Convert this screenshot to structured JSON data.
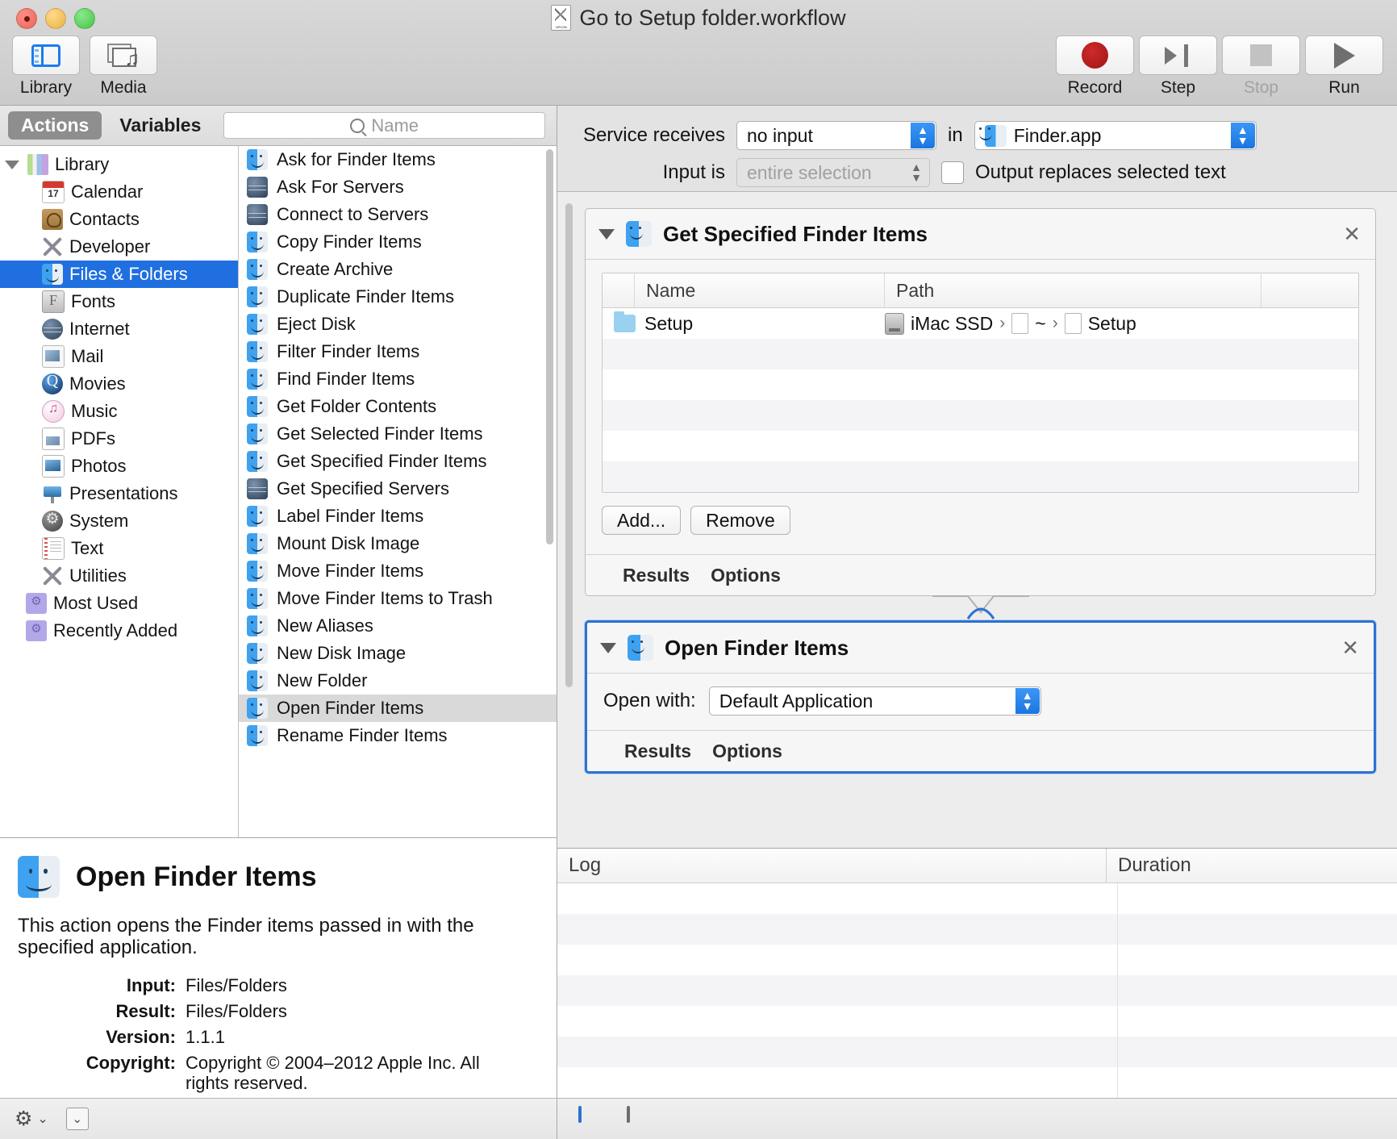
{
  "window": {
    "title": "Go to Setup folder.workflow",
    "title_icon": "workflow-document-icon"
  },
  "toolbar": {
    "left": [
      {
        "label": "Library",
        "icon": "library-panel-icon"
      },
      {
        "label": "Media",
        "icon": "media-browser-icon"
      }
    ],
    "right": [
      {
        "label": "Record",
        "icon": "record-icon",
        "enabled": true
      },
      {
        "label": "Step",
        "icon": "step-icon",
        "enabled": true
      },
      {
        "label": "Stop",
        "icon": "stop-icon",
        "enabled": false
      },
      {
        "label": "Run",
        "icon": "run-icon",
        "enabled": true
      }
    ]
  },
  "library": {
    "tabs": [
      {
        "label": "Actions",
        "selected": true
      },
      {
        "label": "Variables",
        "selected": false
      }
    ],
    "search": {
      "placeholder": "Name",
      "value": "",
      "icon": "search-icon"
    },
    "categories": [
      {
        "label": "Library",
        "icon": "library-books-icon",
        "level": "root",
        "expanded": true,
        "selected": false
      },
      {
        "label": "Calendar",
        "icon": "calendar-icon",
        "level": "child",
        "selected": false
      },
      {
        "label": "Contacts",
        "icon": "contacts-icon",
        "level": "child",
        "selected": false
      },
      {
        "label": "Developer",
        "icon": "developer-tools-icon",
        "level": "child",
        "selected": false
      },
      {
        "label": "Files & Folders",
        "icon": "finder-icon",
        "level": "child",
        "selected": true
      },
      {
        "label": "Fonts",
        "icon": "fonts-icon",
        "level": "child",
        "selected": false
      },
      {
        "label": "Internet",
        "icon": "globe-icon",
        "level": "child",
        "selected": false
      },
      {
        "label": "Mail",
        "icon": "mail-icon",
        "level": "child",
        "selected": false
      },
      {
        "label": "Movies",
        "icon": "quicktime-icon",
        "level": "child",
        "selected": false
      },
      {
        "label": "Music",
        "icon": "itunes-icon",
        "level": "child",
        "selected": false
      },
      {
        "label": "PDFs",
        "icon": "pdf-icon",
        "level": "child",
        "selected": false
      },
      {
        "label": "Photos",
        "icon": "photos-icon",
        "level": "child",
        "selected": false
      },
      {
        "label": "Presentations",
        "icon": "keynote-icon",
        "level": "child",
        "selected": false
      },
      {
        "label": "System",
        "icon": "system-prefs-icon",
        "level": "child",
        "selected": false
      },
      {
        "label": "Text",
        "icon": "textedit-icon",
        "level": "child",
        "selected": false
      },
      {
        "label": "Utilities",
        "icon": "utilities-icon",
        "level": "child",
        "selected": false
      },
      {
        "label": "Most Used",
        "icon": "smart-folder-icon",
        "level": "root2",
        "selected": false
      },
      {
        "label": "Recently Added",
        "icon": "smart-folder-icon",
        "level": "root2",
        "selected": false
      }
    ],
    "actions": [
      {
        "label": "Ask for Finder Items",
        "icon": "finder-icon",
        "selected": false
      },
      {
        "label": "Ask For Servers",
        "icon": "globe-icon",
        "selected": false
      },
      {
        "label": "Connect to Servers",
        "icon": "globe-icon",
        "selected": false
      },
      {
        "label": "Copy Finder Items",
        "icon": "finder-icon",
        "selected": false
      },
      {
        "label": "Create Archive",
        "icon": "finder-icon",
        "selected": false
      },
      {
        "label": "Duplicate Finder Items",
        "icon": "finder-icon",
        "selected": false
      },
      {
        "label": "Eject Disk",
        "icon": "finder-icon",
        "selected": false
      },
      {
        "label": "Filter Finder Items",
        "icon": "finder-icon",
        "selected": false
      },
      {
        "label": "Find Finder Items",
        "icon": "finder-icon",
        "selected": false
      },
      {
        "label": "Get Folder Contents",
        "icon": "finder-icon",
        "selected": false
      },
      {
        "label": "Get Selected Finder Items",
        "icon": "finder-icon",
        "selected": false
      },
      {
        "label": "Get Specified Finder Items",
        "icon": "finder-icon",
        "selected": false
      },
      {
        "label": "Get Specified Servers",
        "icon": "globe-icon",
        "selected": false
      },
      {
        "label": "Label Finder Items",
        "icon": "finder-icon",
        "selected": false
      },
      {
        "label": "Mount Disk Image",
        "icon": "finder-icon",
        "selected": false
      },
      {
        "label": "Move Finder Items",
        "icon": "finder-icon",
        "selected": false
      },
      {
        "label": "Move Finder Items to Trash",
        "icon": "finder-icon",
        "selected": false
      },
      {
        "label": "New Aliases",
        "icon": "finder-icon",
        "selected": false
      },
      {
        "label": "New Disk Image",
        "icon": "finder-icon",
        "selected": false
      },
      {
        "label": "New Folder",
        "icon": "finder-icon",
        "selected": false
      },
      {
        "label": "Open Finder Items",
        "icon": "finder-icon",
        "selected": true
      },
      {
        "label": "Rename Finder Items",
        "icon": "finder-icon",
        "selected": false
      }
    ]
  },
  "info": {
    "icon": "finder-icon",
    "title": "Open Finder Items",
    "description": "This action opens the Finder items passed in with the specified application.",
    "meta": [
      {
        "key": "Input:",
        "value": "Files/Folders"
      },
      {
        "key": "Result:",
        "value": "Files/Folders"
      },
      {
        "key": "Version:",
        "value": "1.1.1"
      },
      {
        "key": "Copyright:",
        "value": "Copyright © 2004–2012 Apple Inc.  All rights reserved."
      }
    ]
  },
  "left_bottom": {
    "gear_label": "gear-menu",
    "gear_glyph": "⚙",
    "chevron_glyph": "⌄",
    "box_glyph": "⌄"
  },
  "service": {
    "receives_label": "Service receives",
    "receives_value": "no input",
    "in_label": "in",
    "app_value": "Finder.app",
    "app_icon": "finder-icon",
    "input_is_label": "Input is",
    "input_is_value": "entire selection",
    "input_is_disabled": true,
    "output_checkbox_label": "Output replaces selected text",
    "output_checkbox_checked": false
  },
  "workflow": {
    "actions": [
      {
        "title": "Get Specified Finder Items",
        "icon": "finder-icon",
        "focused": false,
        "close_glyph": "✕",
        "expanded": true,
        "table": {
          "columns": [
            "Name",
            "Path"
          ],
          "rows": [
            {
              "name": "Setup",
              "name_icon": "folder-icon",
              "path_segments": [
                {
                  "text": "iMac SSD",
                  "icon": "hard-disk-icon"
                },
                {
                  "text": "~",
                  "icon": "document-icon"
                },
                {
                  "text": "Setup",
                  "icon": "document-icon"
                }
              ]
            }
          ],
          "empty_rows": 4
        },
        "buttons": [
          "Add...",
          "Remove"
        ],
        "footer_tabs": [
          "Results",
          "Options"
        ]
      },
      {
        "title": "Open Finder Items",
        "icon": "finder-icon",
        "focused": true,
        "close_glyph": "✕",
        "expanded": true,
        "open_with_label": "Open with:",
        "open_with_value": "Default Application",
        "footer_tabs": [
          "Results",
          "Options"
        ]
      }
    ]
  },
  "log": {
    "columns": [
      "Log",
      "Duration"
    ],
    "rows": []
  },
  "bottom_bar": {
    "buttons": [
      {
        "name": "log-view-button",
        "icon": "list-view-icon",
        "selected": true
      },
      {
        "name": "split-view-button",
        "icon": "split-view-icon",
        "selected": false
      }
    ]
  },
  "colors": {
    "accent": "#1f6fe0",
    "focus_border": "#2a72d4",
    "selection_gray": "#d9d9d9"
  }
}
